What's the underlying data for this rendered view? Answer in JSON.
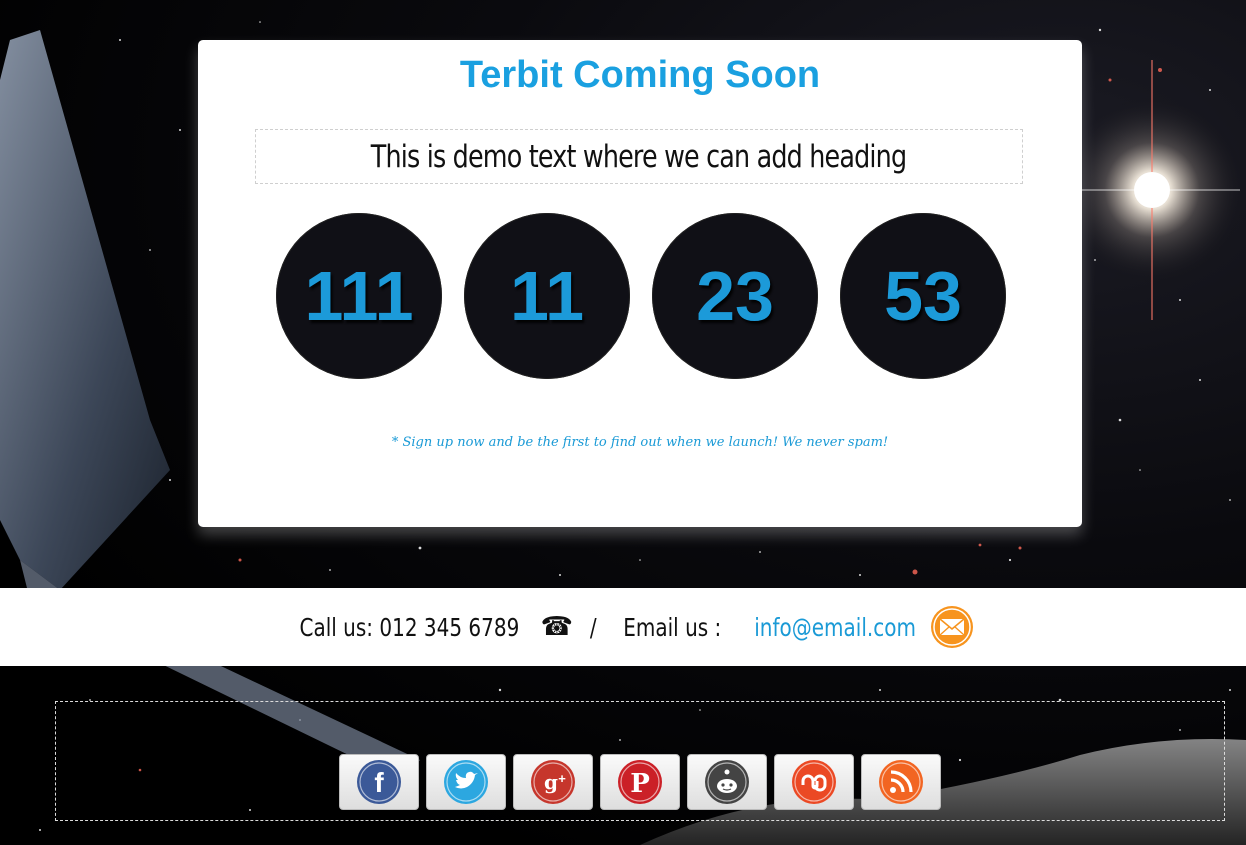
{
  "page": {
    "title": "Terbit Coming Soon",
    "headline": "This is demo text where we can add heading",
    "note": "* Sign up now and be the first to find out when we launch! We never spam!"
  },
  "countdown": {
    "days": "111",
    "hours": "11",
    "minutes": "23",
    "seconds": "53"
  },
  "contact": {
    "call_label": "Call us: 012 345 6789",
    "separator": "/",
    "email_label": "Email us :",
    "email": "info@email.com"
  },
  "social": [
    {
      "name": "facebook",
      "icon": "facebook-icon",
      "color": "#3b5998"
    },
    {
      "name": "twitter",
      "icon": "twitter-icon",
      "color": "#2ca7e0"
    },
    {
      "name": "google-plus",
      "icon": "google-plus-icon",
      "color": "#c6362c"
    },
    {
      "name": "pinterest",
      "icon": "pinterest-icon",
      "color": "#cb2027"
    },
    {
      "name": "reddit",
      "icon": "reddit-icon",
      "color": "#444444"
    },
    {
      "name": "stumbleupon",
      "icon": "stumbleupon-icon",
      "color": "#eb4924"
    },
    {
      "name": "rss",
      "icon": "rss-icon",
      "color": "#f26522"
    }
  ],
  "colors": {
    "accent": "#1aa0e0",
    "dial_bg": "#101016",
    "mail_orange": "#f7941e"
  }
}
